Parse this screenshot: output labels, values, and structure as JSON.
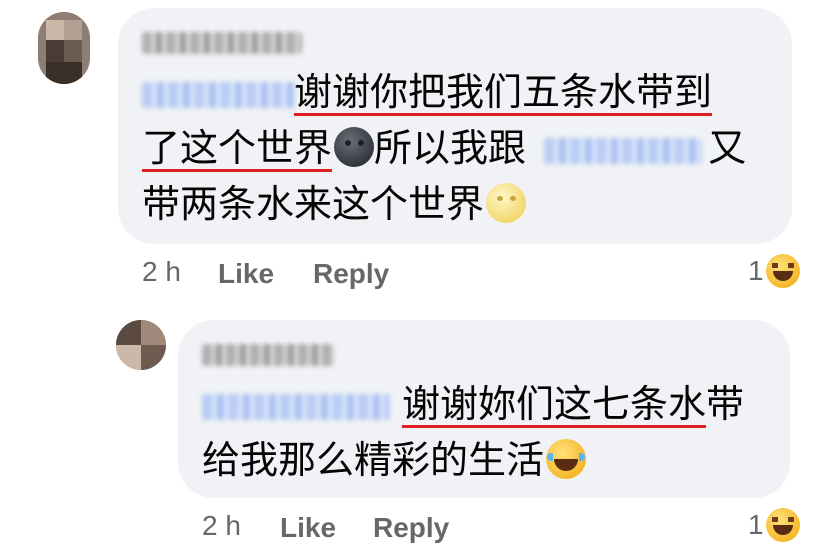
{
  "comment": {
    "line1": {
      "text_a": "谢谢你把我们五条水带到"
    },
    "line2": {
      "text_a": "了这个世界",
      "emoji_a": "new-moon-face-icon",
      "text_b": "所以我跟",
      "text_c": "又"
    },
    "line3": {
      "text_a": "带两条水来这个世界",
      "emoji_b": "full-moon-face-icon"
    },
    "time": "2 h",
    "like_label": "Like",
    "reply_label": "Reply",
    "reaction_count": "1",
    "reaction_icon": "laughing-emoji-icon"
  },
  "reply": {
    "line1": {
      "text_a": "谢谢妳们这七条水",
      "text_b": "带"
    },
    "line2": {
      "text_a": "给我那么精彩的生活",
      "emoji": "tears-of-joy-icon"
    },
    "time": "2 h",
    "like_label": "Like",
    "reply_label": "Reply",
    "reaction_count": "1",
    "reaction_icon": "laughing-emoji-icon"
  },
  "colors": {
    "bubble": "#f0f2f5",
    "meta": "#65676b",
    "underline": "#e02020",
    "mention": "#b9cdf4"
  }
}
